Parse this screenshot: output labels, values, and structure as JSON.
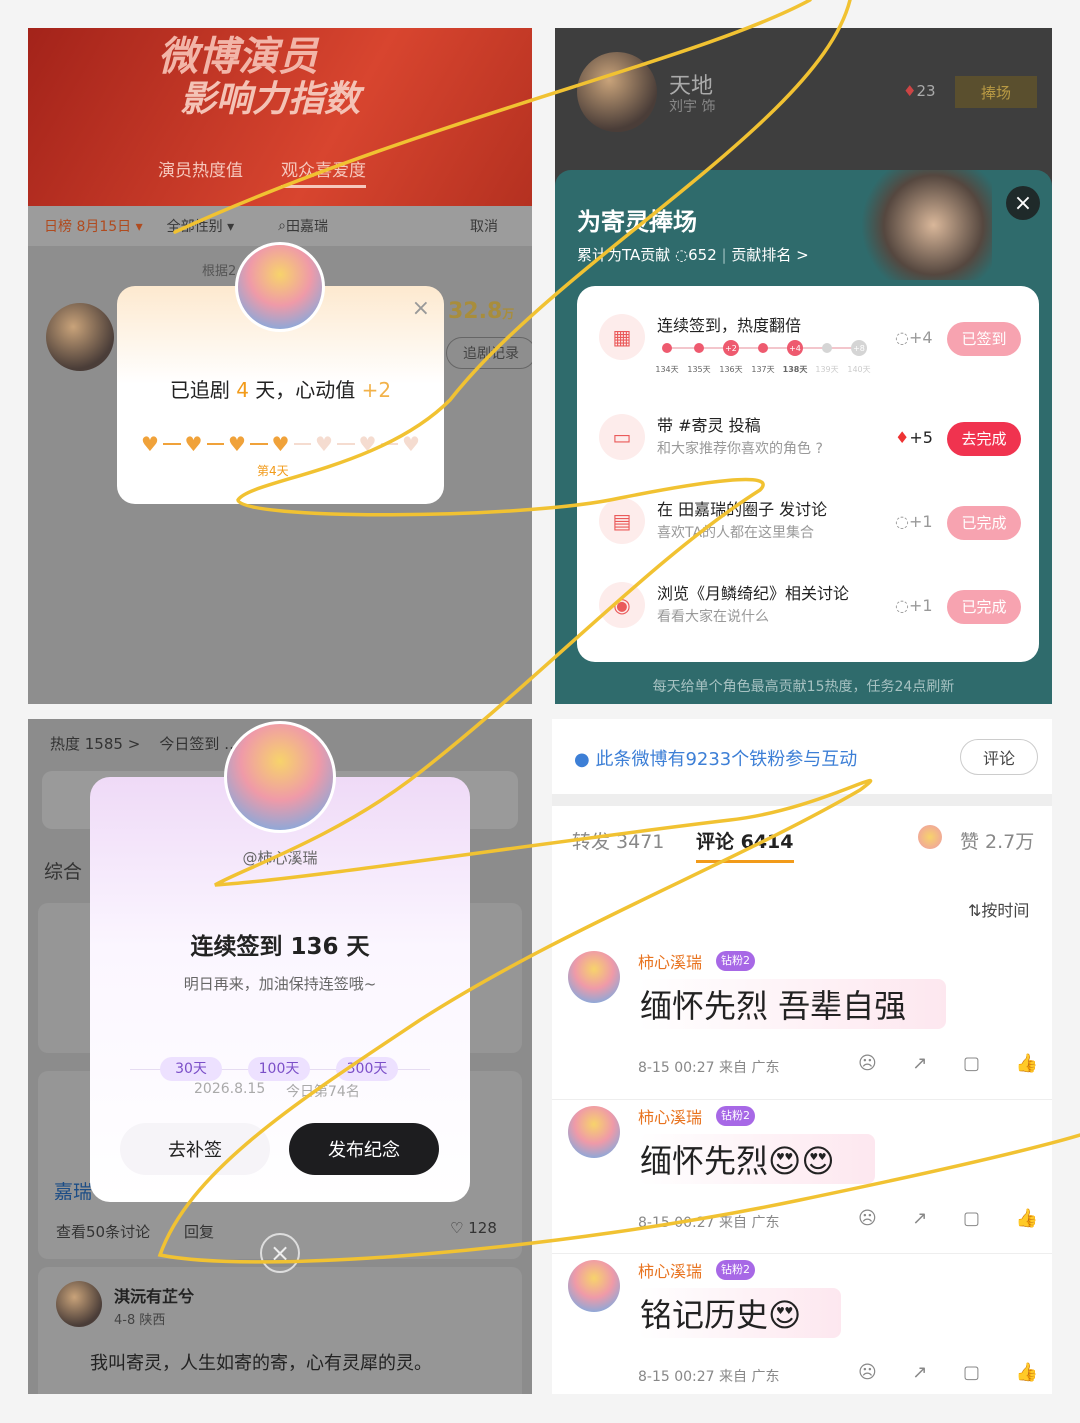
{
  "panel1": {
    "banner_title_line1": "微博演员",
    "banner_title_line2": "影响力指数",
    "tabs": [
      "演员热度值",
      "观众喜爱度"
    ],
    "filter": {
      "date": "日榜 8月15日 ▾",
      "gender": "全部性别 ▾",
      "search": "田嘉瑞",
      "cancel": "取消"
    },
    "note": "根据2 … 计算",
    "score": "32.8",
    "score_unit": "万",
    "record_button": "追剧记录",
    "popup": {
      "text_prefix": "已追剧 ",
      "days": "4",
      "text_mid": " 天，心动值 ",
      "plus": "+2",
      "day_label": "第4天",
      "filled_hearts": 4,
      "total_hearts": 7
    }
  },
  "panel2": {
    "top_name": "天地",
    "top_role": "刘宇 饰",
    "top_heat": "23",
    "top_button": "捧场",
    "title": "为寄灵捧场",
    "contrib_prefix": "累计为TA贡献 ",
    "contrib_value": "652",
    "rank_link": "贡献排名 >",
    "tasks": [
      {
        "title": "连续签到，热度翻倍",
        "sub": "",
        "points": "+4",
        "button": "已签到",
        "done": true,
        "icon": "calendar-icon"
      },
      {
        "title": "带 #寄灵 投稿",
        "sub": "和大家推荐你喜欢的角色 ?",
        "points": "+5",
        "button": "去完成",
        "done": false,
        "icon": "video-icon"
      },
      {
        "title": "在 田嘉瑞的圈子 发讨论",
        "sub": "喜欢TA的人都在这里集合",
        "points": "+1",
        "button": "已完成",
        "done": true,
        "icon": "chat-icon"
      },
      {
        "title": "浏览《月鳞绮纪》相关讨论",
        "sub": "看看大家在说什么",
        "points": "+1",
        "button": "已完成",
        "done": true,
        "icon": "eye-icon"
      }
    ],
    "streak": [
      {
        "day": "134天",
        "mark": "",
        "state": "done"
      },
      {
        "day": "135天",
        "mark": "",
        "state": "done"
      },
      {
        "day": "136天",
        "mark": "+2",
        "state": "done"
      },
      {
        "day": "137天",
        "mark": "",
        "state": "done"
      },
      {
        "day": "138天",
        "mark": "+4",
        "state": "today"
      },
      {
        "day": "139天",
        "mark": "",
        "state": "future"
      },
      {
        "day": "140天",
        "mark": "+8",
        "state": "future"
      }
    ],
    "footer": "每天给单个角色最高贡献15热度，任务24点刷新"
  },
  "panel3": {
    "topbar": "热度 1585 >    今日签到 …  讨论 17条",
    "side_label": "综合",
    "username": "@柿心溪瑞",
    "title": "连续签到 136 天",
    "subtitle": "明日再来，加油保持连签哦~",
    "milestones": [
      "30天",
      "100天",
      "300天"
    ],
    "date": "2026.8.15",
    "rank": "今日第74名",
    "btn_makeup": "去补签",
    "btn_publish": "发布纪念",
    "bg_name": "淇沅有芷兮",
    "bg_meta": "4-8 陕西",
    "bg_text": "我叫寄灵，人生如寄的寄，心有灵犀的灵。",
    "bg_link": "查看50条讨论",
    "bg_reply": "回复",
    "bg_likes": "128",
    "bg_user_text": "嘉瑞"
  },
  "panel4": {
    "fans_text": "此条微博有9233个铁粉参与互动",
    "comment_button": "评论",
    "tab_repost": "转发 3471",
    "tab_comment": "评论 6414",
    "tab_likes": "赞 2.7万",
    "sort": "按时间",
    "comments": [
      {
        "name": "柿心溪瑞",
        "badge": "钻粉2",
        "text": "缅怀先烈 吾辈自强",
        "emoji": "",
        "meta": "8-15 00:27 来自 广东"
      },
      {
        "name": "柿心溪瑞",
        "badge": "钻粉2",
        "text": "缅怀先烈",
        "emoji": "😍😍",
        "meta": "8-15 00:27 来自 广东"
      },
      {
        "name": "柿心溪瑞",
        "badge": "钻粉2",
        "text": "铭记历史",
        "emoji": "😍",
        "meta": "8-15 00:27 来自 广东"
      }
    ]
  },
  "colors": {
    "accent_red": "#f0334f",
    "done_pink": "#f7a3b0",
    "sheet_teal": "#2f6b6c",
    "orange": "#e8731f",
    "highlight_yellow": "#f1c232"
  }
}
